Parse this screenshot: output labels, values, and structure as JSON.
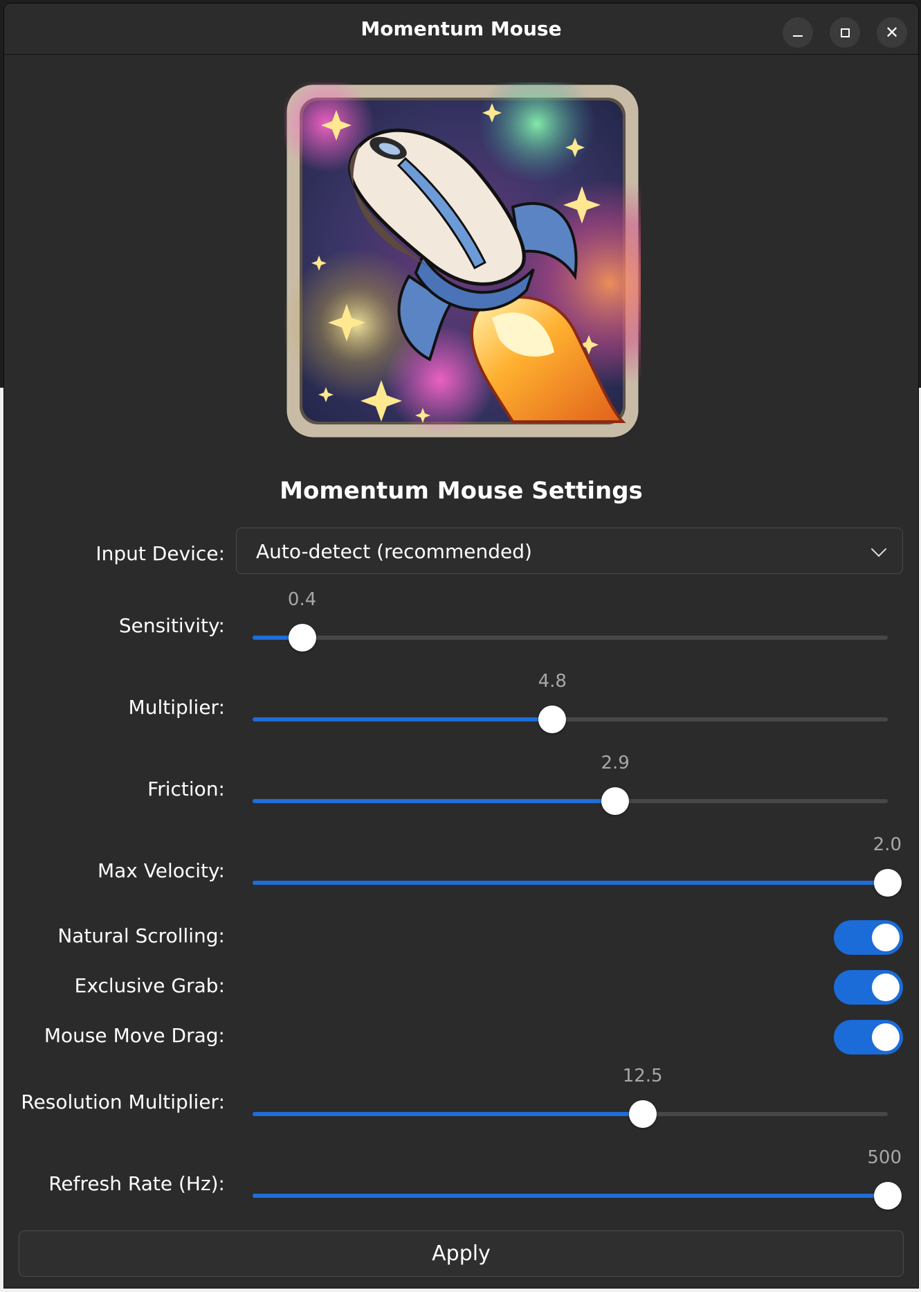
{
  "window": {
    "title": "Momentum Mouse"
  },
  "heading": "Momentum Mouse Settings",
  "input_device": {
    "label": "Input Device:",
    "value": "Auto-detect (recommended)"
  },
  "sliders": [
    {
      "label": "Sensitivity:",
      "value": "0.4",
      "fraction": 0.078
    },
    {
      "label": "Multiplier:",
      "value": "4.8",
      "fraction": 0.472
    },
    {
      "label": "Friction:",
      "value": "2.9",
      "fraction": 0.571
    },
    {
      "label": "Max Velocity:",
      "value": "2.0",
      "fraction": 1.0
    },
    {
      "label": "Resolution Multiplier:",
      "value": "12.5",
      "fraction": 0.614
    },
    {
      "label": "Refresh Rate (Hz):",
      "value": "500",
      "fraction": 1.0
    }
  ],
  "toggles": [
    {
      "label": "Natural Scrolling:",
      "on": true
    },
    {
      "label": "Exclusive Grab:",
      "on": true
    },
    {
      "label": "Mouse Move Drag:",
      "on": true
    }
  ],
  "apply_label": "Apply",
  "colors": {
    "accent": "#1b6bd8",
    "window_bg": "#2b2b2b",
    "text": "#ffffff",
    "value_text": "#a8a8a8"
  },
  "icons": {
    "logo": "rocket-mouse-logo",
    "minimize": "minimize-icon",
    "maximize": "maximize-icon",
    "close": "close-icon",
    "dropdown": "chevron-down-icon"
  }
}
